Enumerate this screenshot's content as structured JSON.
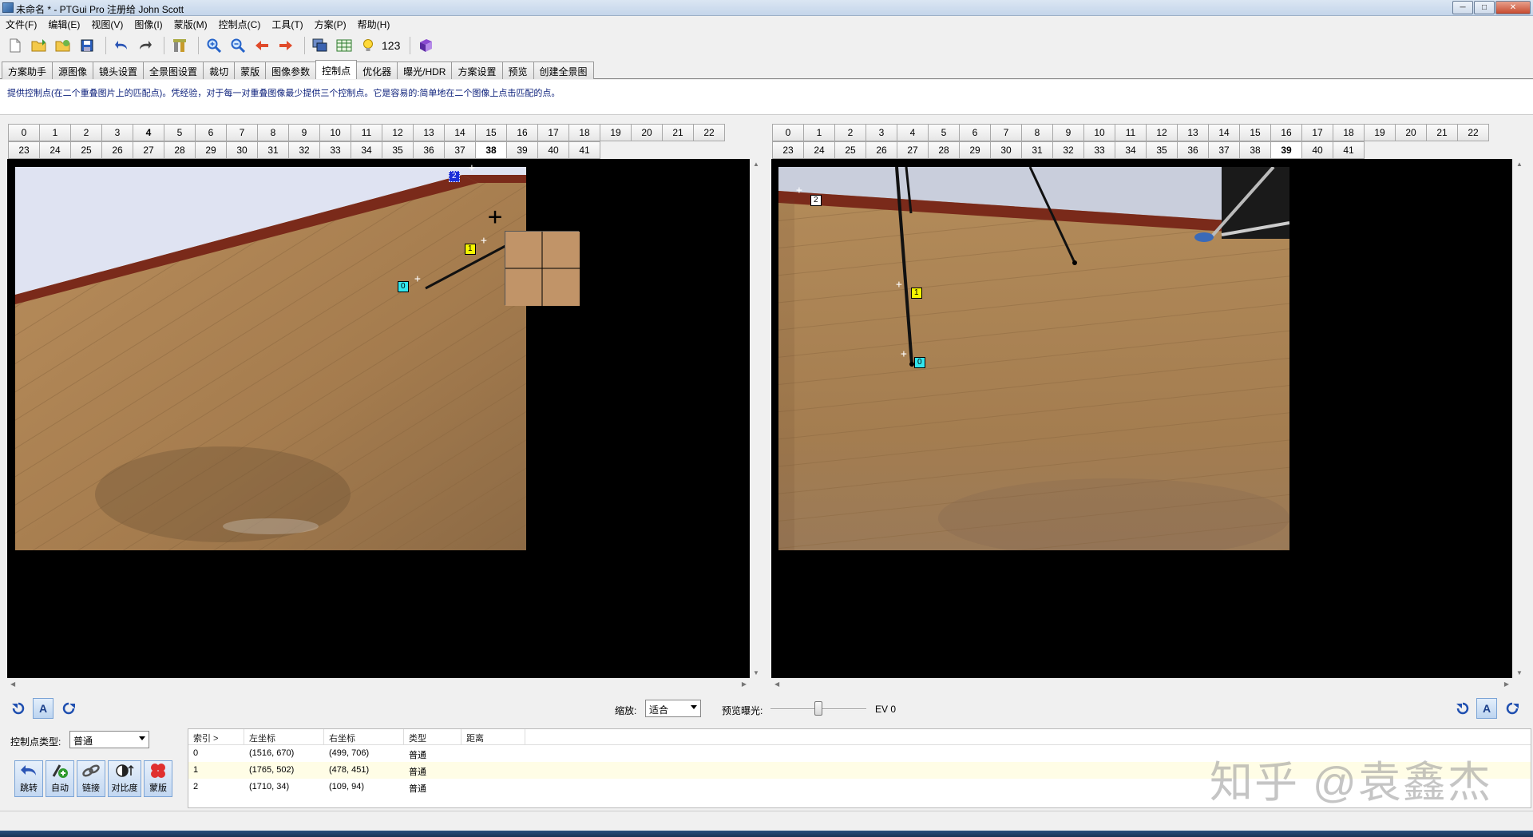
{
  "window": {
    "title": "未命名 * - PTGui Pro 注册给 John Scott"
  },
  "menu": [
    "文件(F)",
    "编辑(E)",
    "视图(V)",
    "图像(I)",
    "蒙版(M)",
    "控制点(C)",
    "工具(T)",
    "方案(P)",
    "帮助(H)"
  ],
  "toolbar": {
    "number_label": "123"
  },
  "tabs": [
    "方案助手",
    "源图像",
    "镜头设置",
    "全景图设置",
    "裁切",
    "蒙版",
    "图像参数",
    "控制点",
    "优化器",
    "曝光/HDR",
    "方案设置",
    "预览",
    "创建全景图"
  ],
  "active_tab": "控制点",
  "info_text": "提供控制点(在二个重叠图片上的匹配点)。凭经验，对于每一对重叠图像最少提供三个控制点。它是容易的:简单地在二个图像上点击匹配的点。",
  "left_selector": {
    "row1": [
      "0",
      "1",
      "2",
      "3",
      "4",
      "5",
      "6",
      "7",
      "8",
      "9",
      "10",
      "11",
      "12",
      "13",
      "14",
      "15",
      "16",
      "17",
      "18",
      "19",
      "20",
      "21",
      "22"
    ],
    "row2": [
      "23",
      "24",
      "25",
      "26",
      "27",
      "28",
      "29",
      "30",
      "31",
      "32",
      "33",
      "34",
      "35",
      "36",
      "37",
      "38",
      "39",
      "40",
      "41"
    ],
    "selected": "38",
    "bold": "4"
  },
  "right_selector": {
    "row1": [
      "0",
      "1",
      "2",
      "3",
      "4",
      "5",
      "6",
      "7",
      "8",
      "9",
      "10",
      "11",
      "12",
      "13",
      "14",
      "15",
      "16",
      "17",
      "18",
      "19",
      "20",
      "21",
      "22"
    ],
    "row2": [
      "23",
      "24",
      "25",
      "26",
      "27",
      "28",
      "29",
      "30",
      "31",
      "32",
      "33",
      "34",
      "35",
      "36",
      "37",
      "38",
      "39",
      "40",
      "41"
    ],
    "selected": "39"
  },
  "left_markers": {
    "m0": "0",
    "m1": "1",
    "m2": "2"
  },
  "right_markers": {
    "m0": "0",
    "m1": "1",
    "m2": "2"
  },
  "zoom": {
    "label": "缩放:",
    "value": "适合"
  },
  "exposure": {
    "label": "预览曝光:",
    "value": "EV 0",
    "level": 0.5
  },
  "ab_label": "A",
  "control_point_type": {
    "label": "控制点类型:",
    "value": "普通"
  },
  "action_buttons": [
    "跳转",
    "自动",
    "链接",
    "对比度",
    "蒙版"
  ],
  "table": {
    "headers": [
      "索引 >",
      "左坐标",
      "右坐标",
      "类型",
      "距离"
    ],
    "rows": [
      [
        "0",
        "(1516, 670)",
        "(499, 706)",
        "普通",
        ""
      ],
      [
        "1",
        "(1765, 502)",
        "(478, 451)",
        "普通",
        ""
      ],
      [
        "2",
        "(1710, 34)",
        "(109, 94)",
        "普通",
        ""
      ]
    ]
  },
  "watermark": "知乎 @袁鑫杰",
  "colors": {
    "marker_cyan": "#33e6ee",
    "marker_yellow": "#f5f500",
    "marker_blue": "#1b2fd8"
  }
}
